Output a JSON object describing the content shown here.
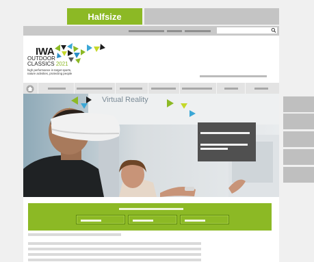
{
  "tabs": {
    "active_label": "Halfsize"
  },
  "header": {
    "logo": {
      "brand": "IWA",
      "line1": "OUTDOOR",
      "line2": "CLASSICS",
      "year": "2021",
      "tagline1": "high performance in target sports,",
      "tagline2": "nature activities, protecting people"
    },
    "search": {
      "placeholder": ""
    }
  },
  "hero": {
    "alt": "Person wearing a VR headset at a Virtual Reality exhibition booth",
    "booth_sign": "Virtual Reality"
  },
  "icons": {
    "search": "search-icon",
    "home": "home-icon"
  },
  "colors": {
    "accent_green": "#8cb925",
    "gray_placeholder": "#c4c4c4",
    "overlay_box": "#505050"
  }
}
